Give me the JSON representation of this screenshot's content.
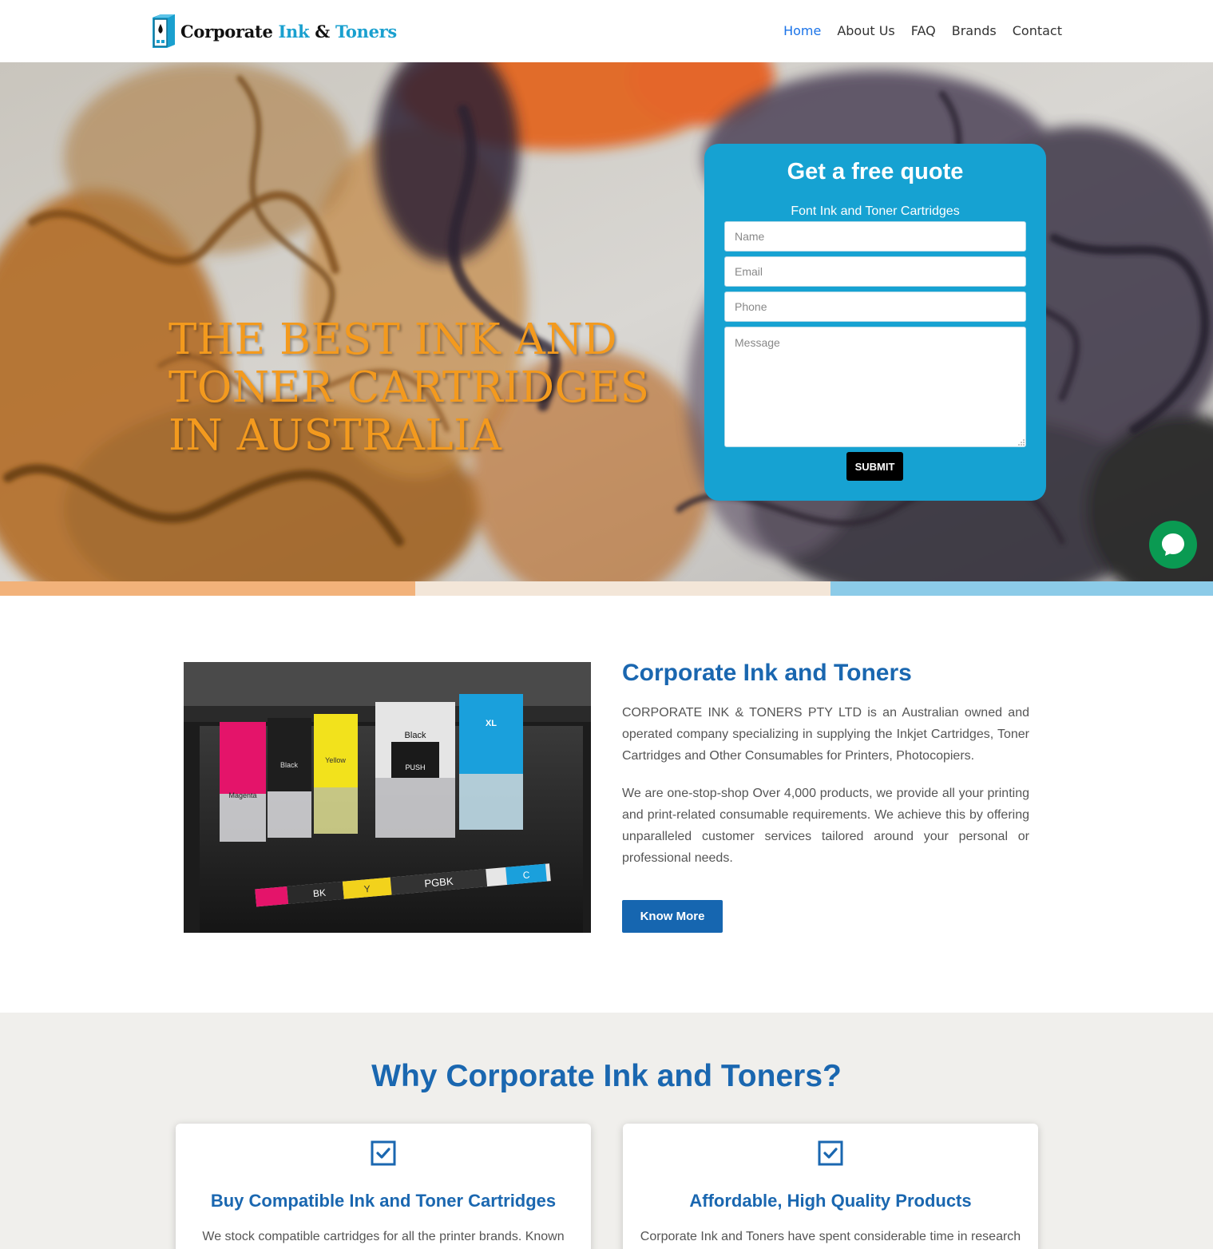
{
  "header": {
    "logo": {
      "word1": "Corporate",
      "word2": "Ink",
      "word3": "&",
      "word4": "Toners"
    },
    "nav": [
      {
        "label": "Home",
        "active": true
      },
      {
        "label": "About Us"
      },
      {
        "label": "FAQ"
      },
      {
        "label": "Brands"
      },
      {
        "label": "Contact"
      }
    ]
  },
  "hero": {
    "title": "THE BEST INK AND TONER CARTRIDGES IN AUSTRALIA",
    "quote_form": {
      "title": "Get a free quote",
      "subtitle": "Font Ink and Toner Cartridges",
      "name_placeholder": "Name",
      "email_placeholder": "Email",
      "phone_placeholder": "Phone",
      "message_placeholder": "Message",
      "submit_label": "SUBMIT"
    }
  },
  "about": {
    "title": "Corporate Ink and Toners",
    "paragraph1": "CORPORATE INK & TONERS PTY LTD is an Australian owned and operated company specializing in supplying the Inkjet Cartridges, Toner Cartridges and Other Consumables for Printers, Photocopiers.",
    "paragraph2": "We are one-stop-shop Over 4,000 products, we provide all your printing and print-related consumable requirements. We achieve this by offering unparalleled customer services tailored around your personal or professional needs.",
    "button_label": "Know More",
    "image_labels": {
      "magenta": "Magenta",
      "black": "Black",
      "yellow": "Yellow",
      "black_xl": "Black",
      "cyan": "XL",
      "push": "PUSH",
      "tray_bk": "BK",
      "tray_y": "Y",
      "tray_pgbk": "PGBK",
      "tray_c": "C"
    }
  },
  "why": {
    "title": "Why Corporate Ink and Toners?",
    "cards": [
      {
        "title": "Buy Compatible Ink and Toner Cartridges",
        "text": "We stock compatible cartridges for all the printer brands. Known"
      },
      {
        "title": "Affordable, High Quality Products",
        "text": "Corporate Ink and Toners have spent considerable time in research"
      }
    ]
  },
  "colors": {
    "accent_blue": "#1a67b0",
    "quote_bg": "#16a2d2",
    "hero_title": "#f39a1e",
    "chat_green": "#0a9a52",
    "nav_active": "#1a73e8"
  },
  "icons": [
    "logo-cartridge-icon",
    "chat-bubble-icon",
    "checkbox-icon"
  ]
}
